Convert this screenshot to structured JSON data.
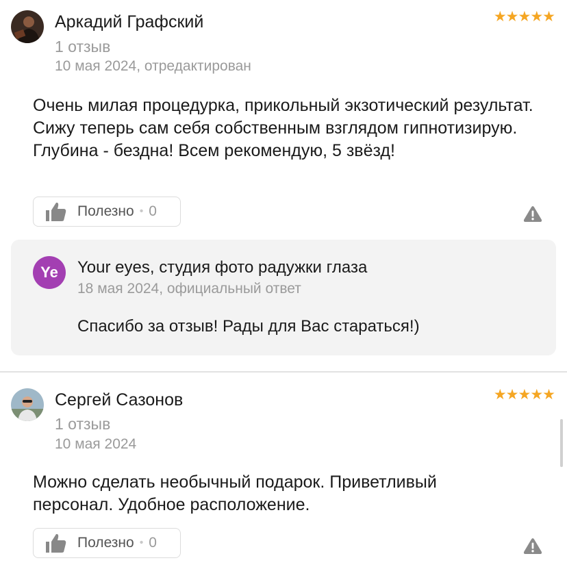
{
  "reviews": [
    {
      "author": "Аркадий Графский",
      "review_count": "1 отзыв",
      "date": "10 мая 2024, отредактирован",
      "stars": "★★★★★",
      "rating": 5,
      "text": "Очень милая процедурка, прикольный экзотический результат. Сижу теперь сам себя собственным взглядом гипнотизирую. Глубина - бездна! Всем рекомендую, 5 звёзд!",
      "useful_label": "Полезно",
      "useful_count": "0",
      "reply": {
        "org_initials": "Ye",
        "org_name": "Your eyes, студия фото радужки глаза",
        "date": "18 мая 2024, официальный ответ",
        "text": "Спасибо за отзыв! Рады для Вас стараться!)"
      }
    },
    {
      "author": "Сергей Сазонов",
      "review_count": "1 отзыв",
      "date": "10 мая 2024",
      "stars": "★★★★★",
      "rating": 5,
      "text": "Можно сделать необычный подарок. Приветливый персонал. Удобное расположение.",
      "useful_label": "Полезно",
      "useful_count": "0"
    }
  ],
  "colors": {
    "star": "#f5a623",
    "org_avatar": "#a33fb2",
    "muted_text": "#9a9a9a",
    "reply_bg": "#f3f3f3"
  },
  "icons": [
    "thumbs-up-icon",
    "warning-icon"
  ]
}
